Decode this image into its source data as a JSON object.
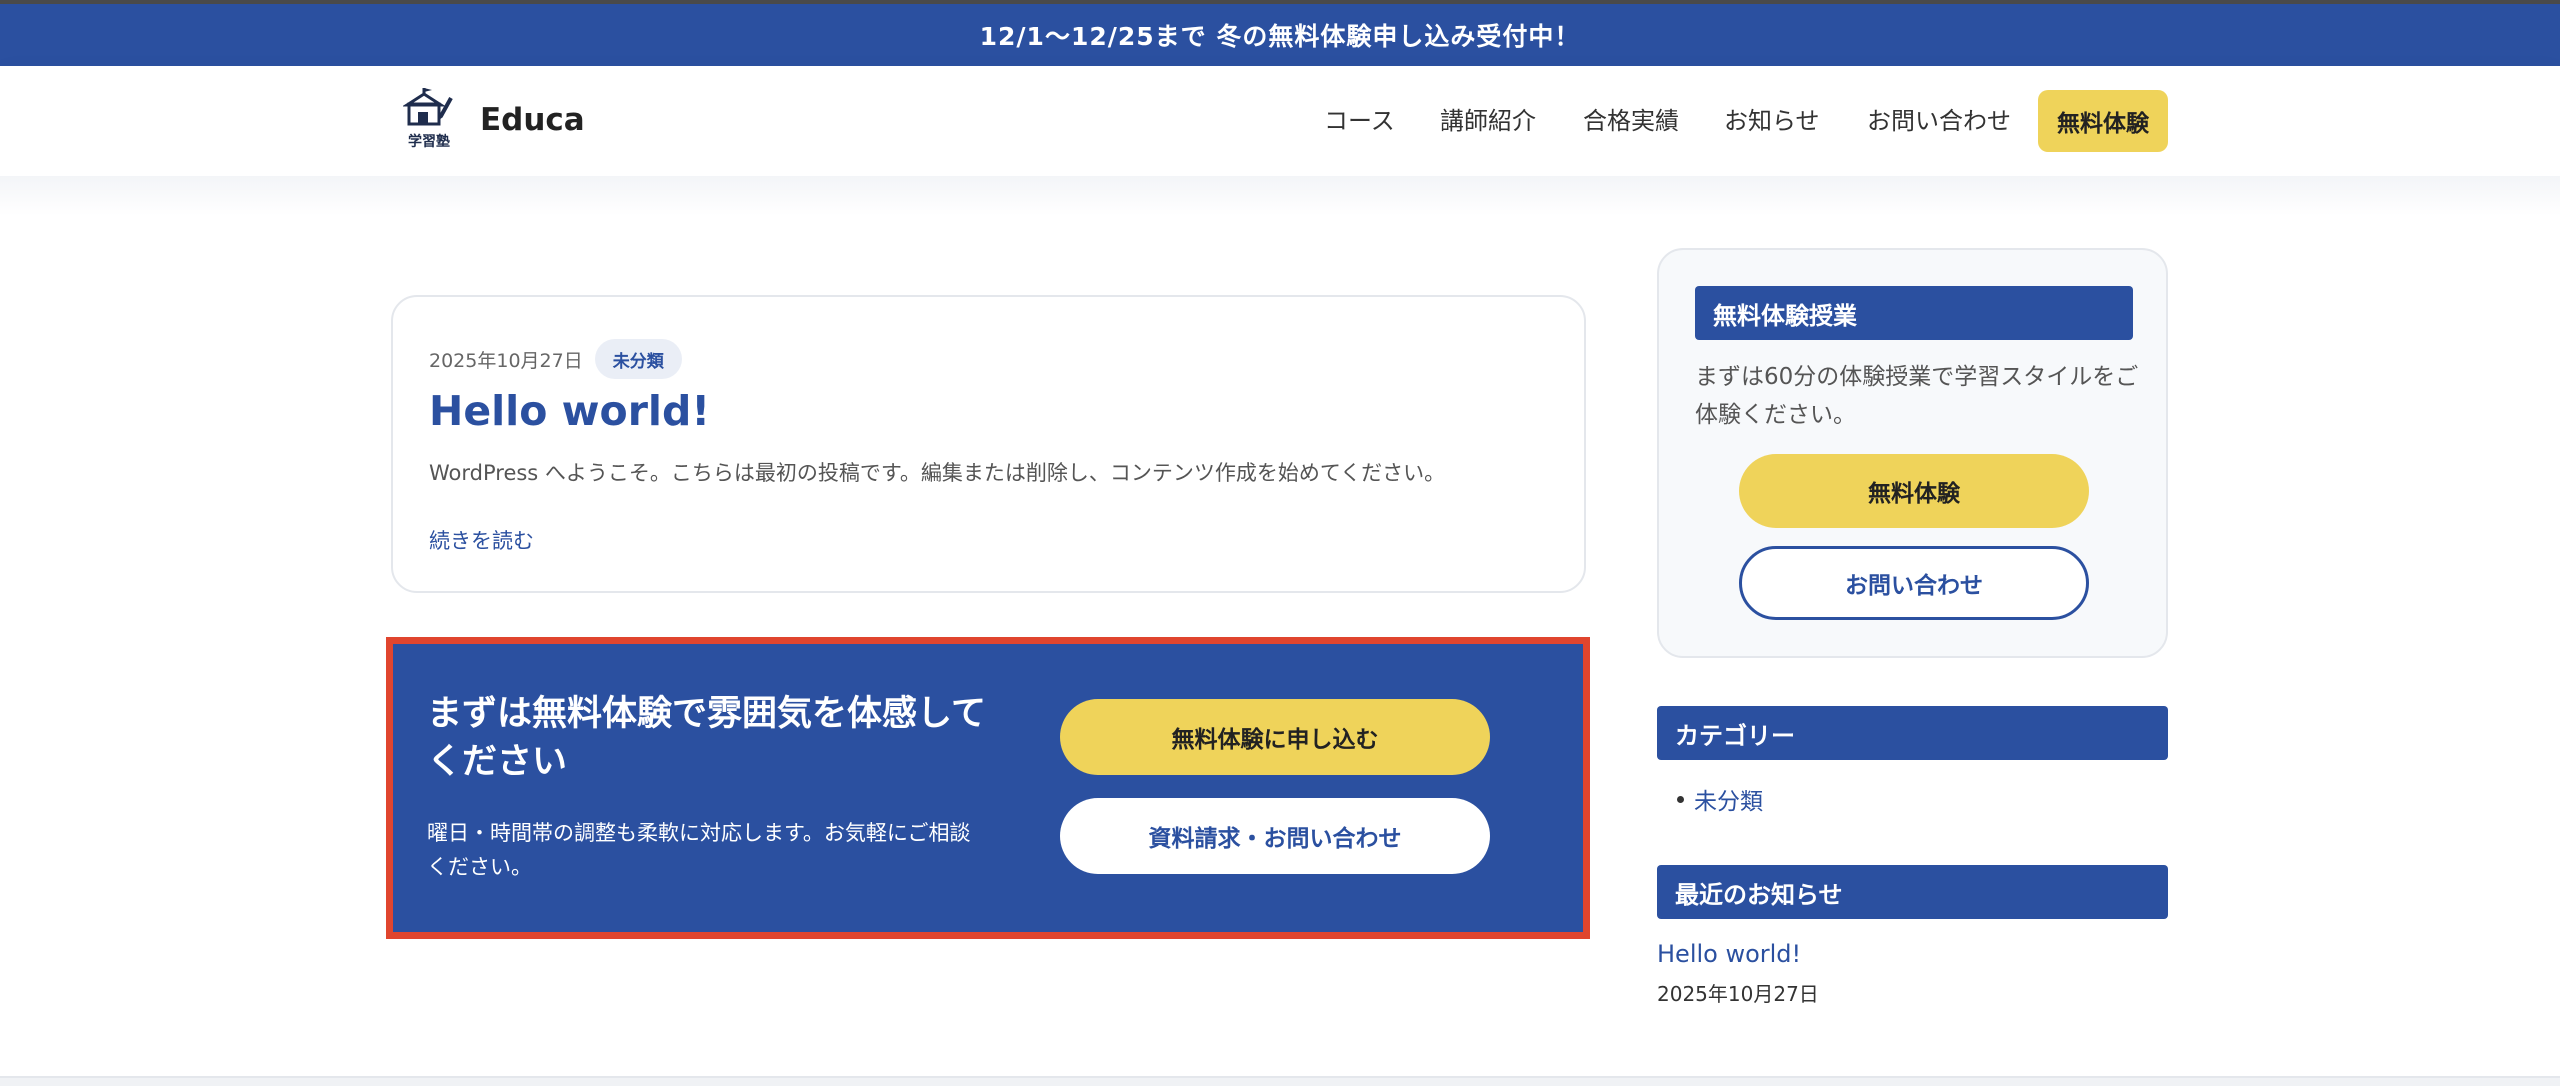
{
  "announcement": "12/1〜12/25まで 冬の無料体験申し込み受付中！",
  "header": {
    "logo_text": "学習塾",
    "brand": "Educa",
    "nav": [
      "コース",
      "講師紹介",
      "合格実績",
      "お知らせ",
      "お問い合わせ"
    ],
    "cta_label": "無料体験"
  },
  "post": {
    "date": "2025年10月27日",
    "category": "未分類",
    "title": "Hello world!",
    "excerpt": "WordPress へようこそ。こちらは最初の投稿です。編集または削除し、コンテンツ作成を始めてください。",
    "read_more": "続きを読む"
  },
  "cta": {
    "title": "まずは無料体験で雰囲気を体感してください",
    "description": "曜日・時間帯の調整も柔軟に対応します。お気軽にご相談ください。",
    "primary_button": "無料体験に申し込む",
    "secondary_button": "資料請求・お問い合わせ"
  },
  "sidebar": {
    "trial": {
      "heading": "無料体験授業",
      "text": "まずは60分の体験授業で学習スタイルをご体験ください。",
      "primary_button": "無料体験",
      "secondary_button": "お問い合わせ"
    },
    "categories": {
      "heading": "カテゴリー",
      "items": [
        "未分類"
      ]
    },
    "recent": {
      "heading": "最近のお知らせ",
      "items": [
        {
          "title": "Hello world!",
          "date": "2025年10月27日"
        }
      ]
    }
  },
  "colors": {
    "primary": "#2b50a0",
    "accent": "#efd35a",
    "highlight_border": "#e0452e"
  }
}
